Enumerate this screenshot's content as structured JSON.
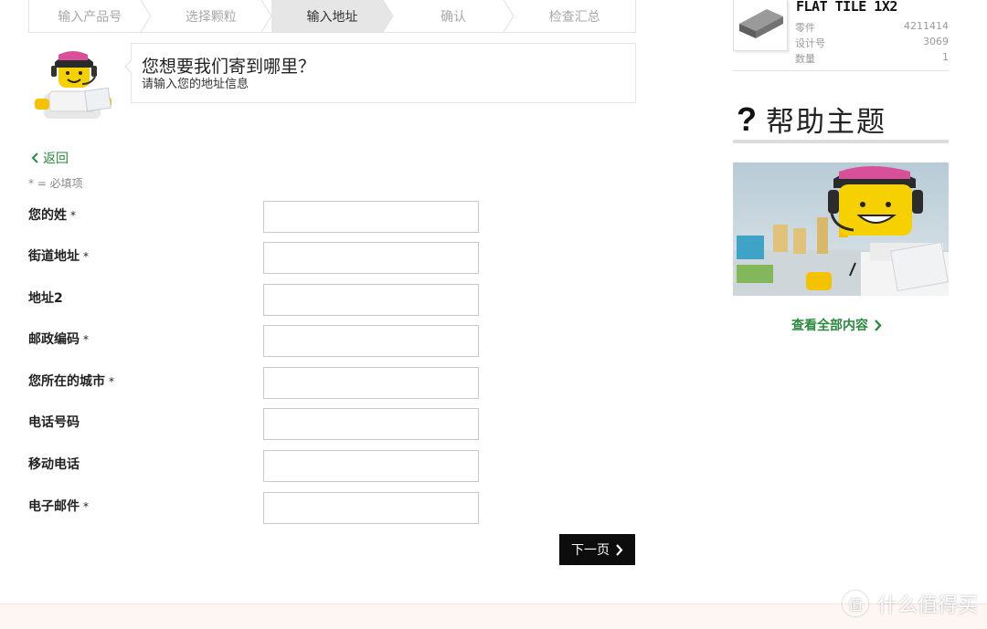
{
  "steps": [
    {
      "label": "输入产品号",
      "active": false
    },
    {
      "label": "选择颗粒",
      "active": false
    },
    {
      "label": "输入地址",
      "active": true
    },
    {
      "label": "确认",
      "active": false
    },
    {
      "label": "检查汇总",
      "active": false
    }
  ],
  "hint": {
    "title": "您想要我们寄到哪里？",
    "subtitle": "请输入您的地址信息"
  },
  "back_label": "返回",
  "required_note": "* = 必填项",
  "form": {
    "fields": [
      {
        "label": "您的姓",
        "required": "*",
        "value": ""
      },
      {
        "label": "街道地址",
        "required": "*",
        "value": ""
      },
      {
        "label": "地址2",
        "required": "",
        "value": ""
      },
      {
        "label": "邮政编码",
        "required": "*",
        "value": ""
      },
      {
        "label": "您所在的城市",
        "required": "*",
        "value": ""
      },
      {
        "label": "电话号码",
        "required": "",
        "value": ""
      },
      {
        "label": "移动电话",
        "required": "",
        "value": ""
      },
      {
        "label": "电子邮件",
        "required": "*",
        "value": ""
      }
    ]
  },
  "next_label": "下一页",
  "part": {
    "name": "FLAT TILE 1X2",
    "rows": [
      {
        "key": "零件",
        "value": "4211414"
      },
      {
        "key": "设计号",
        "value": "3069"
      },
      {
        "key": "数量",
        "value": "1"
      }
    ]
  },
  "help": {
    "icon": "?",
    "title": "帮助主题",
    "view_all": "查看全部内容"
  },
  "watermark": {
    "icon": "值",
    "text": "什么值得买"
  },
  "colors": {
    "accent_green": "#2a8a3e",
    "button_black": "#0d0d0d",
    "active_step": "#e6e6e6"
  }
}
